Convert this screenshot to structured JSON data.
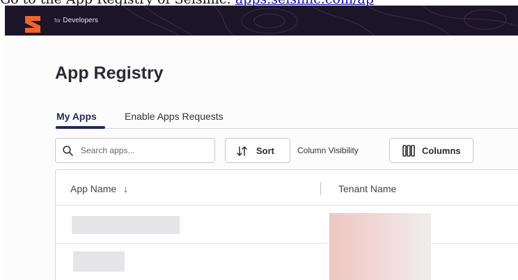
{
  "caption": {
    "text": "Go to the App Registry of Seismic: ",
    "link": "apps.seismic.com/ap"
  },
  "header": {
    "brand_prefix": "for",
    "brand_label": "Developers"
  },
  "page": {
    "title": "App Registry"
  },
  "tabs": [
    {
      "label": "My Apps",
      "active": true
    },
    {
      "label": "Enable Apps Requests",
      "active": false
    }
  ],
  "toolbar": {
    "search_placeholder": "Search apps...",
    "sort_label": "Sort",
    "column_visibility_label": "Column Visibility",
    "columns_label": "Columns"
  },
  "table": {
    "columns": [
      {
        "label": "App Name",
        "sort_indicator": "↓"
      },
      {
        "label": "Tenant Name"
      }
    ],
    "rows": [
      {
        "app_name": "",
        "tenant_name": ""
      },
      {
        "app_name": "",
        "tenant_name": ""
      }
    ]
  },
  "colors": {
    "header_bg": "#1c1527",
    "logo_orange": "#f0642d",
    "accent_navy": "#1f2a5c"
  }
}
